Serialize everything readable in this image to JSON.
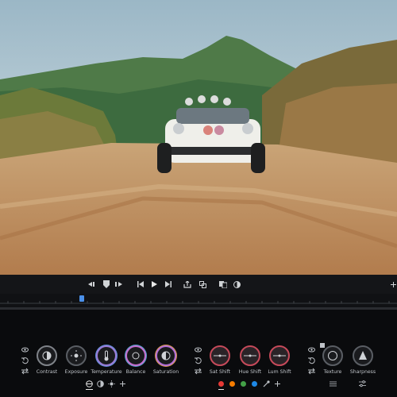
{
  "viewer": {
    "description_icon": "video-frame"
  },
  "toolbar": {
    "buttons": [
      "mark-in-icon",
      "marker-icon",
      "mark-out-icon",
      "skip-start-icon",
      "play-icon",
      "skip-end-icon",
      "export-icon",
      "crop-icon",
      "compare-icon",
      "color-wheel-icon",
      "add-icon"
    ]
  },
  "adjust": {
    "light": [
      {
        "id": "contrast",
        "label": "Contrast",
        "icon": "contrast-icon"
      },
      {
        "id": "exposure",
        "label": "Exposure",
        "icon": "exposure-icon"
      },
      {
        "id": "temperature",
        "label": "Temperature",
        "icon": "thermometer-icon"
      },
      {
        "id": "balance",
        "label": "Balance",
        "icon": "balance-icon"
      },
      {
        "id": "saturation",
        "label": "Saturation",
        "icon": "saturation-icon"
      }
    ],
    "color": [
      {
        "id": "sat-shift",
        "label": "Sat Shift"
      },
      {
        "id": "hue-shift",
        "label": "Hue Shift"
      },
      {
        "id": "lum-shift",
        "label": "Lum Shift"
      }
    ],
    "detail": [
      {
        "id": "texture",
        "label": "Texture",
        "icon": "texture-icon"
      },
      {
        "id": "sharpness",
        "label": "Sharpness",
        "icon": "sharpness-icon"
      }
    ]
  },
  "colors": {
    "accent": "#4a8fe8",
    "swatches": [
      "#e53935",
      "#f57c00",
      "#43a047",
      "#1e88e5"
    ]
  }
}
